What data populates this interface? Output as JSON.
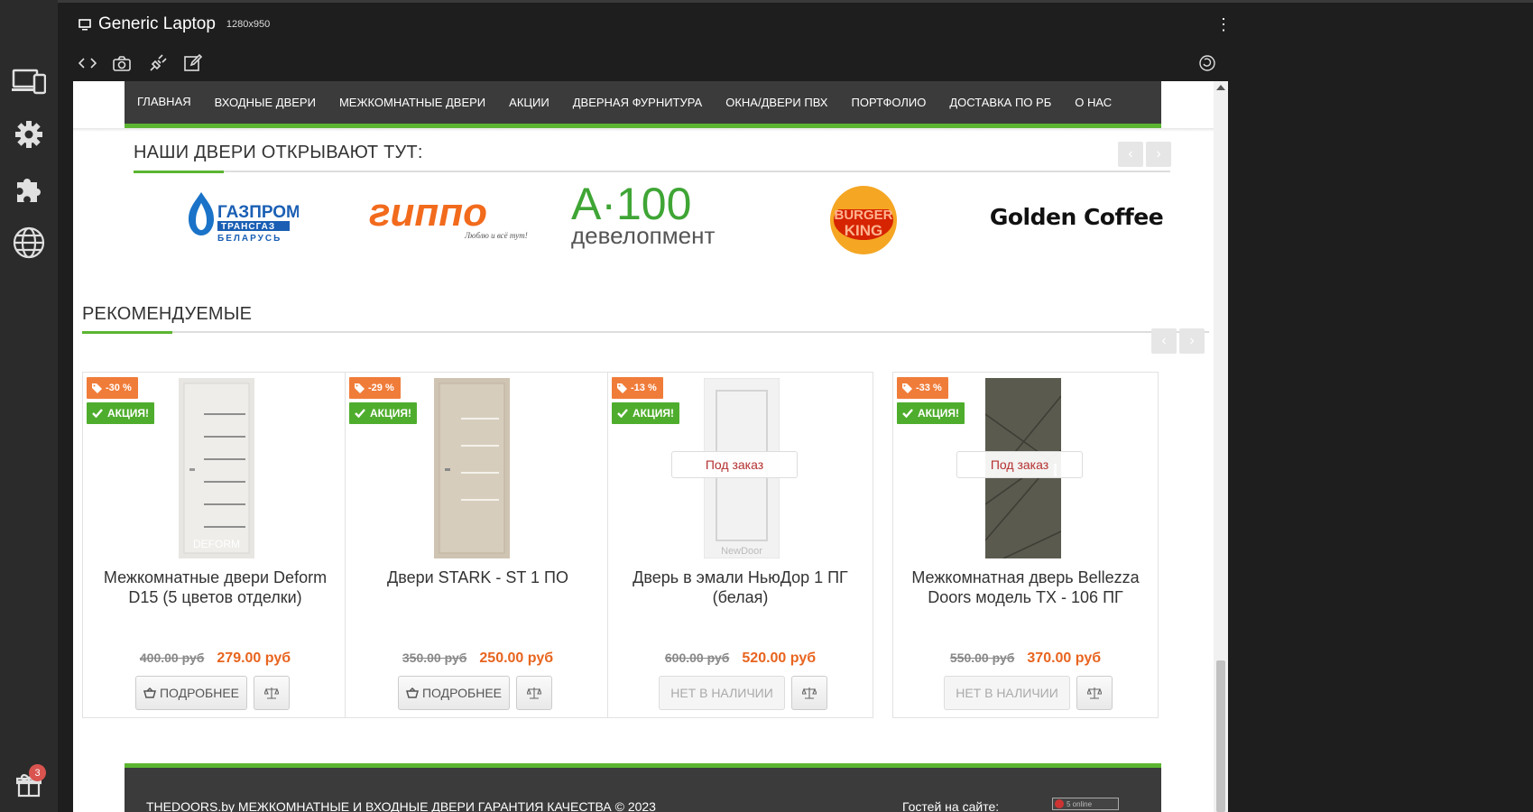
{
  "device": {
    "name": "Generic Laptop",
    "resolution": "1280x950"
  },
  "sidebar": {
    "gift_badge": "3"
  },
  "nav": {
    "items": [
      "ГЛАВНАЯ",
      "ВХОДНЫЕ ДВЕРИ",
      "МЕЖКОМНАТНЫЕ ДВЕРИ",
      "АКЦИИ",
      "ДВЕРНАЯ ФУРНИТУРА",
      "ОКНА/ДВЕРИ ПВХ",
      "ПОРТФОЛИО",
      "ДОСТАВКА ПО РБ",
      "О НАС"
    ]
  },
  "partners": {
    "title": "НАШИ ДВЕРИ ОТКРЫВАЮТ ТУТ:",
    "logos": [
      {
        "name": "gazprom",
        "text1": "ГАЗПРОМ",
        "text2": "ТРАНСГАЗ",
        "text3": "БЕЛАРУСЬ"
      },
      {
        "name": "gippo",
        "text1": "гиппо",
        "text2": "Люблю и всё тут!"
      },
      {
        "name": "a100",
        "text1": "A·100",
        "text2": "девелопмент"
      },
      {
        "name": "burger-king",
        "text1": "BURGER",
        "text2": "KING"
      },
      {
        "name": "golden-coffee",
        "text1": "Golden Coffee"
      }
    ]
  },
  "recommended": {
    "title": "РЕКОМЕНДУЕМЫЕ",
    "action_label": "АКЦИЯ!",
    "products": [
      {
        "discount": "-30 %",
        "name": "Межкомнатные двери Deform D15 (5 цветов отделки)",
        "old_price": "400.00 руб",
        "new_price": "279.00 руб",
        "button": "ПОДРОБНЕЕ",
        "order": "",
        "door_color": "#e8e6e2",
        "watermark": "DEFORM"
      },
      {
        "discount": "-29 %",
        "name": "Двери STARK - ST 1 ПО",
        "old_price": "350.00 руб",
        "new_price": "250.00 руб",
        "button": "ПОДРОБНЕЕ",
        "order": "",
        "door_color": "#cfc4b2",
        "watermark": ""
      },
      {
        "discount": "-13 %",
        "name": "Дверь в эмали НьюДор 1 ПГ (белая)",
        "old_price": "600.00 руб",
        "new_price": "520.00 руб",
        "button": "НЕТ В НАЛИЧИИ",
        "order": "Под заказ",
        "door_color": "#f2f2f2",
        "watermark": "NewDoor"
      },
      {
        "discount": "-33 %",
        "name": "Межкомнатная дверь Bellezza Doors модель ТХ - 106 ПГ",
        "old_price": "550.00 руб",
        "new_price": "370.00 руб",
        "button": "НЕТ В НАЛИЧИИ",
        "order": "Под заказ",
        "door_color": "#5b5a4f",
        "watermark": ""
      }
    ]
  },
  "footer": {
    "copyright": "THEDOORS.by МЕЖКОМНАТНЫЕ И ВХОДНЫЕ ДВЕРИ ГАРАНТИЯ КАЧЕСТВА © 2023",
    "guests_label": "Гостей на сайте:",
    "counter": "5 online"
  }
}
